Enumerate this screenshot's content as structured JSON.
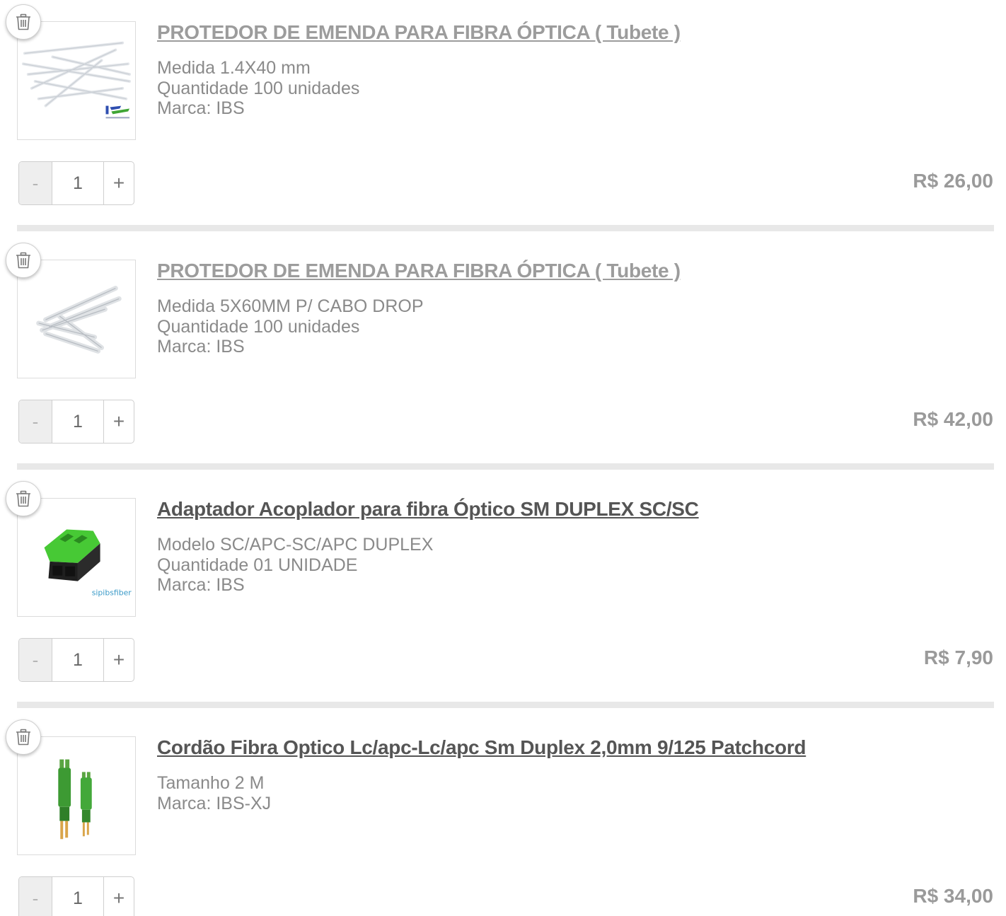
{
  "cart": {
    "items": [
      {
        "title": "PROTEDOR DE EMENDA PARA FIBRA ÓPTICA ( Tubete )",
        "specs": [
          "Medida 1.4X40 mm",
          "Quantidade 100 unidades",
          "Marca: IBS"
        ],
        "quantity": "1",
        "price": "R$ 26,00",
        "image_icon": "fiber-splice-protector-thin-image",
        "logo_text": ""
      },
      {
        "title": "PROTEDOR DE EMENDA PARA FIBRA ÓPTICA ( Tubete )",
        "specs": [
          "Medida 5X60MM P/ CABO DROP",
          "Quantidade 100 unidades",
          "Marca: IBS"
        ],
        "quantity": "1",
        "price": "R$ 42,00",
        "image_icon": "fiber-splice-protector-drop-image",
        "logo_text": ""
      },
      {
        "title": "Adaptador Acoplador para fibra Óptico SM DUPLEX SC/SC",
        "specs": [
          "Modelo SC/APC-SC/APC DUPLEX",
          "Quantidade 01 UNIDADE",
          "Marca: IBS"
        ],
        "quantity": "1",
        "price": "R$ 7,90",
        "image_icon": "sc-duplex-adapter-image",
        "logo_text": "sipibsfiber"
      },
      {
        "title": "Cordão Fibra Optico Lc/apc-Lc/apc Sm Duplex 2,0mm 9/125 Patchcord",
        "specs": [
          "Tamanho 2 M",
          "Marca: IBS-XJ"
        ],
        "quantity": "1",
        "price": "R$ 34,00",
        "image_icon": "lc-patchcord-image",
        "logo_text": ""
      }
    ],
    "minus_label": "-",
    "plus_label": "+",
    "remove_icon": "trash-icon",
    "colors": {
      "muted_title": "#9c9c9c",
      "dark_title": "#555555",
      "divider": "#e8e8e8",
      "adapter_green": "#4cd137"
    }
  }
}
